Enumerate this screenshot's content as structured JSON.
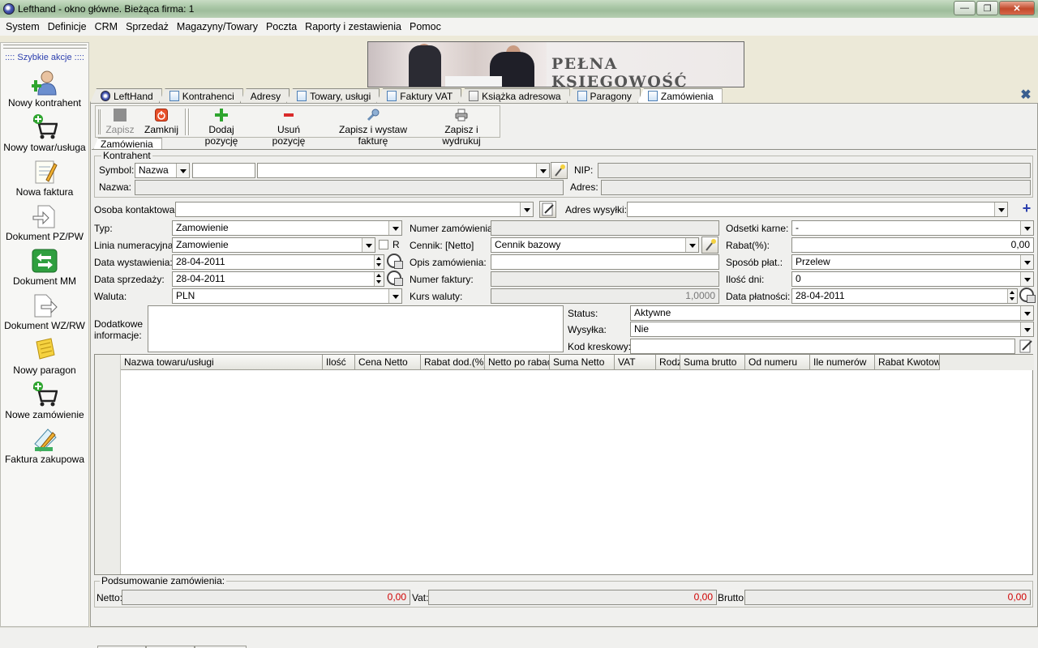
{
  "window": {
    "title": "Lefthand - okno główne. Bieżąca firma: 1"
  },
  "menu": [
    "System",
    "Definicje",
    "CRM",
    "Sprzedaż",
    "Magazyny/Towary",
    "Poczta",
    "Raporty i zestawienia",
    "Pomoc"
  ],
  "quick_actions": {
    "header": ":::: Szybkie akcje ::::",
    "items": [
      {
        "label": "Nowy kontrahent",
        "icon": "user-add-icon"
      },
      {
        "label": "Nowy towar/usługa",
        "icon": "cart-add-icon"
      },
      {
        "label": "Nowa faktura",
        "icon": "invoice-icon"
      },
      {
        "label": "Dokument PZ/PW",
        "icon": "document-in-icon"
      },
      {
        "label": "Dokument MM",
        "icon": "transfer-icon"
      },
      {
        "label": "Dokument WZ/RW",
        "icon": "document-out-icon"
      },
      {
        "label": "Nowy paragon",
        "icon": "receipt-icon"
      },
      {
        "label": "Nowe zamówienie",
        "icon": "cart-order-icon"
      },
      {
        "label": "Faktura zakupowa",
        "icon": "purchase-invoice-icon"
      }
    ]
  },
  "banner": {
    "text": "PEŁNA KSIĘGOWOŚĆ"
  },
  "tabs": [
    "LeftHand",
    "Kontrahenci",
    "Adresy",
    "Towary, usługi",
    "Faktury VAT",
    "Książka adresowa",
    "Paragony",
    "Zamówienia"
  ],
  "toolbar": {
    "save": "Zapisz",
    "close": "Zamknij",
    "add_position": "Dodaj pozycję",
    "remove_position": "Usuń pozycję",
    "save_invoice": "Zapisz i wystaw fakturę",
    "save_print": "Zapisz i wydrukuj"
  },
  "inner_tab": "Zamówienia",
  "contractor": {
    "group_label": "Kontrahent",
    "symbol_label": "Symbol:",
    "symbol_mode": "Nazwa",
    "name_label": "Nazwa:",
    "nip_label": "NIP:",
    "address_label": "Adres:"
  },
  "form": {
    "contact_label": "Osoba kontaktowa:",
    "shipping_address_label": "Adres wysyłki:",
    "type_label": "Typ:",
    "type_value": "Zamowienie",
    "numbering_label": "Linia numeracyjna:",
    "numbering_value": "Zamowienie",
    "r_label": "R",
    "issue_date_label": "Data wystawienia:",
    "issue_date": "28-04-2011",
    "sale_date_label": "Data sprzedaży:",
    "sale_date": "28-04-2011",
    "currency_label": "Waluta:",
    "currency": "PLN",
    "order_number_label": "Numer zamówienia:",
    "pricelist_label": "Cennik: [Netto]",
    "pricelist_value": "Cennik bazowy",
    "order_desc_label": "Opis zamówienia:",
    "invoice_number_label": "Numer faktury:",
    "exchange_rate_label": "Kurs waluty:",
    "exchange_rate": "1,0000",
    "penalty_label": "Odsetki karne:",
    "penalty_value": "-",
    "discount_label": "Rabat(%):",
    "discount_value": "0,00",
    "payment_label": "Sposób płat.:",
    "payment_value": "Przelew",
    "days_label": "Ilość dni:",
    "days_value": "0",
    "due_date_label": "Data płatności:",
    "due_date": "28-04-2011",
    "extra_info_label_1": "Dodatkowe",
    "extra_info_label_2": "informacje:",
    "status_label": "Status:",
    "status_value": "Aktywne",
    "shipping_label": "Wysyłka:",
    "shipping_value": "Nie",
    "barcode_label": "Kod kreskowy:"
  },
  "grid": {
    "columns": [
      "Nazwa towaru/usługi",
      "Ilość",
      "Cena Netto",
      "Rabat dod.(%)",
      "Netto po rabacie",
      "Suma Netto",
      "VAT",
      "Rodzaj",
      "Suma brutto",
      "Od numeru",
      "Ile numerów",
      "Rabat Kwotowy"
    ],
    "rows": []
  },
  "summary": {
    "label": "Podsumowanie zamówienia:",
    "net_label": "Netto:",
    "net_value": "0,00",
    "vat_label": "Vat:",
    "vat_value": "0,00",
    "gross_label": "Brutto:",
    "gross_value": "0,00"
  },
  "colors": {
    "accent_blue": "#2c3fae",
    "zero_value_red": "#d00000"
  }
}
